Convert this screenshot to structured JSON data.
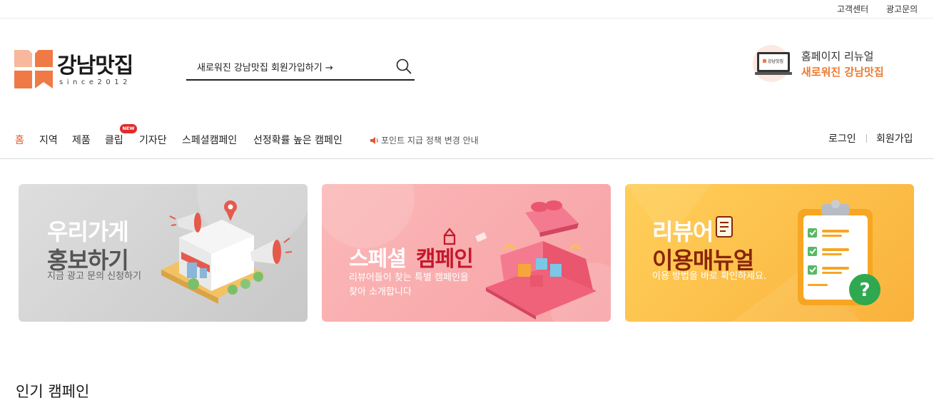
{
  "topbar": {
    "customer_center": "고객센터",
    "ad_inquiry": "광고문의"
  },
  "logo": {
    "name": "강남맛집",
    "since": "since2012",
    "mark_color": "#ef7a45"
  },
  "search": {
    "placeholder": "새로워진 강남맛집 회원가입하기 →",
    "icon": "search-icon"
  },
  "promo": {
    "line1": "홈페이지 리뉴얼",
    "line2": "새로워진 강남맛집",
    "laptop_text": "강남맛집",
    "accent": "#ee7a2f"
  },
  "nav": {
    "items": [
      {
        "label": "홈"
      },
      {
        "label": "지역"
      },
      {
        "label": "제품"
      },
      {
        "label": "클립"
      },
      {
        "label": "기자단"
      },
      {
        "label": "스페셜캠페인"
      },
      {
        "label": "선정확률 높은 캠페인"
      }
    ],
    "new_badge": "NEW",
    "notice": "포인트 지급 정책 변경 안내",
    "login": "로그인",
    "join": "회원가입",
    "active_color": "#e4572e"
  },
  "banners": [
    {
      "title1": "우리가게",
      "title2": "홍보하기",
      "subtitle": "지금 광고 문의 신청하기"
    },
    {
      "title1": "스페셜",
      "title2": "캠페인",
      "subtitle1": "리뷰어들이 찾는 특별 캠페인을",
      "subtitle2": "찾아 소개합니다"
    },
    {
      "title1": "리뷰어",
      "title2": "이용매뉴얼",
      "subtitle": "이용 방법을 바로 확인하세요."
    }
  ],
  "section": {
    "title": "인기 캠페인"
  }
}
